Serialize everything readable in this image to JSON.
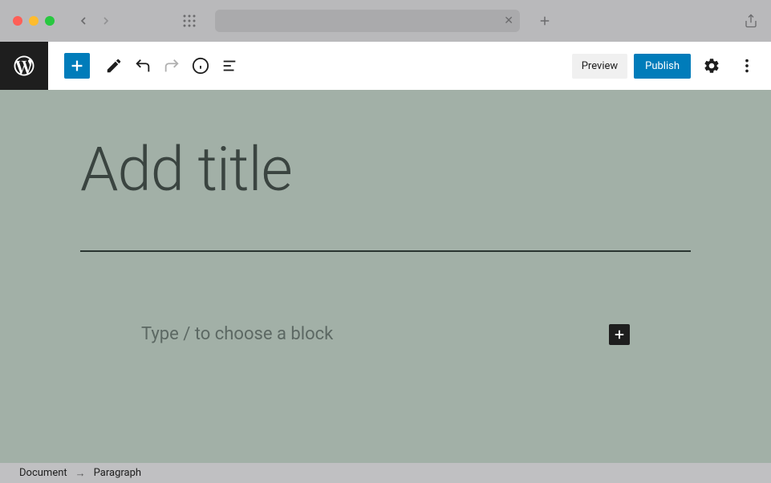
{
  "browser": {
    "address": "",
    "close_glyph": "✕",
    "plus_glyph": "+"
  },
  "toolbar": {
    "preview_label": "Preview",
    "publish_label": "Publish"
  },
  "editor": {
    "title_placeholder": "Add title",
    "paragraph_placeholder": "Type / to choose a block"
  },
  "breadcrumb": {
    "root": "Document",
    "arrow": "→",
    "current": "Paragraph"
  },
  "colors": {
    "canvas_bg": "#a2b0a7",
    "wp_black": "#1e1e1e",
    "wp_blue": "#007cba"
  }
}
